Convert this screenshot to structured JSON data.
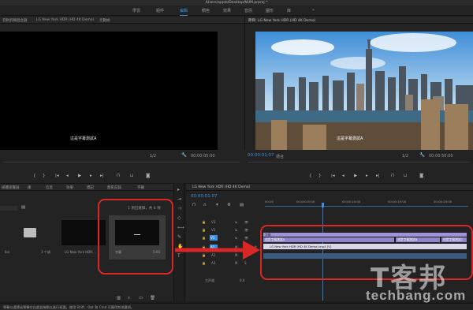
{
  "app": {
    "window_title": "/Users/apple/Desktop/NUM.prproj *"
  },
  "workspaces": [
    {
      "label": "學習",
      "active": false
    },
    {
      "label": "組件",
      "active": false
    },
    {
      "label": "編輯",
      "active": true
    },
    {
      "label": "顏色",
      "active": false
    },
    {
      "label": "效果",
      "active": false
    },
    {
      "label": "音訊",
      "active": false
    },
    {
      "label": "圖形",
      "active": false
    },
    {
      "label": "库",
      "active": false
    },
    {
      "label": "»",
      "active": false
    }
  ],
  "source_monitor": {
    "tabs": [
      "音軌剪輯混合器",
      "LG New York HDR (HD 4K Demo)",
      "元數據"
    ],
    "subtitle": "這是字幕測試A",
    "timecode_left": "",
    "fraction": "1/2",
    "timecode_right": "00:00:05:00"
  },
  "program_monitor": {
    "tab": "節目: LG New York HDR (HD 4K Demo)",
    "subtitle": "這是字幕測試A",
    "timecode": "00:00:01:07",
    "fit": "適合",
    "fraction": "1/2",
    "timecode_right": "00:00:50:00"
  },
  "project_panel": {
    "tabs": [
      "媒體瀏覽器",
      "庫",
      "信息",
      "效果",
      "標記",
      "歷史記錄",
      "字幕"
    ],
    "selection_info": "1 項已選擇，共 4 項",
    "items": [
      {
        "label": "bin"
      },
      {
        "label": "3 个項"
      },
      {
        "label": "LG New York HDR..."
      },
      {
        "label": "字幕",
        "duration": "5:00"
      }
    ]
  },
  "timeline": {
    "tab": "LG New York HDR (HD 4K Demo)",
    "timecode": "00:00:01:07",
    "ruler": [
      "00:00",
      "00:00:05:00",
      "00:00:10:00",
      "00:00:15:00",
      "00:00:20:00"
    ],
    "tracks": [
      {
        "name": "V3"
      },
      {
        "name": "V2"
      },
      {
        "name": "V1"
      },
      {
        "name": "A1"
      },
      {
        "name": "A2"
      },
      {
        "name": "A3"
      }
    ],
    "master_label": "主声道",
    "master_value": "0.0",
    "clips": {
      "caption_clip_a": "這是字幕測試A",
      "caption_clip_b": "這是字幕測試B",
      "caption_clip_c": "這是字幕測試C",
      "caption_header": "字幕",
      "video_clip": "LG New York HDR (HD 4K Demo).mp4 [V]"
    }
  },
  "status_bar": {
    "text": "單擊以選擇或單擊空白處並拖動以進行框選。使用 Shift、Opt 和 Cmd 可獲得其他選項。"
  },
  "watermark": {
    "line1": "T客邦",
    "line2": "techbang.com"
  },
  "colors": {
    "accent": "#3d8fe0",
    "annotation": "#d92626",
    "caption_clip": "#8f83c9",
    "video_clip": "#5c7fbf"
  }
}
